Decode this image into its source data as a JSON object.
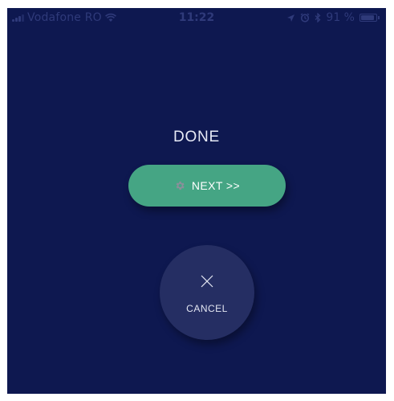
{
  "status_bar": {
    "carrier": "Vodafone RO",
    "time": "11:22",
    "battery_percent": "91 %",
    "battery_level": 0.91,
    "icons": [
      "signal-icon",
      "wifi-icon",
      "location-icon",
      "alarm-icon",
      "bluetooth-icon",
      "battery-icon"
    ]
  },
  "screen": {
    "title": "DONE",
    "next_button": {
      "label": "NEXT >>",
      "icon": "gear-icon",
      "color": "#45a584"
    },
    "cancel_button": {
      "label": "CANCEL",
      "icon": "close-icon"
    }
  },
  "colors": {
    "background": "#0e1850",
    "accent": "#45a584",
    "cancel_bg": "#252e63"
  }
}
